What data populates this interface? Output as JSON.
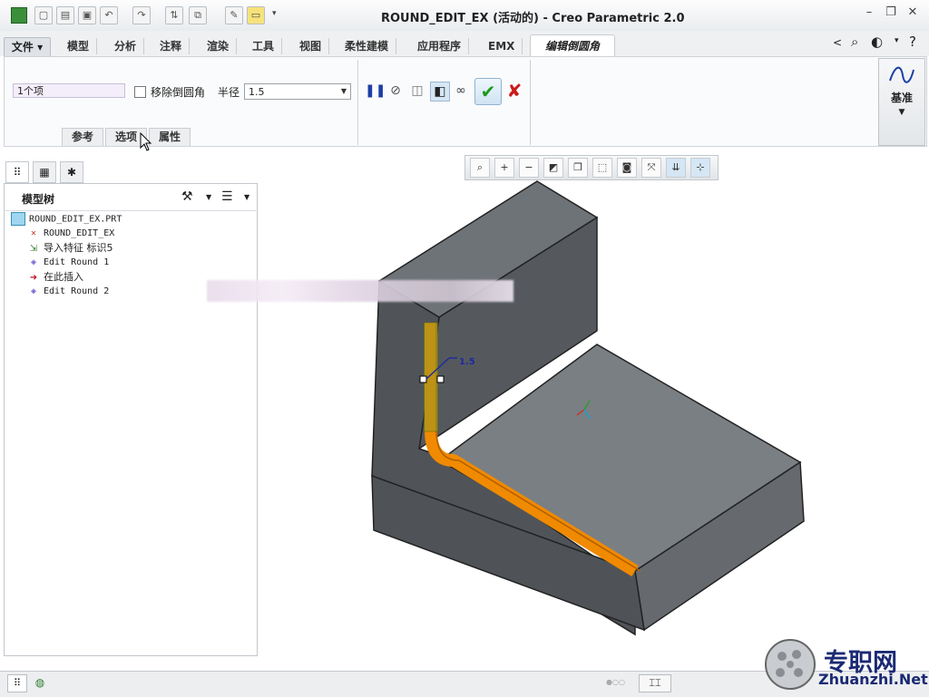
{
  "window": {
    "title": "ROUND_EDIT_EX (活动的) - Creo Parametric 2.0"
  },
  "ribbon": {
    "file_menu": "文件",
    "tabs": [
      "模型",
      "分析",
      "注释",
      "渲染",
      "工具",
      "视图",
      "柔性建模",
      "应用程序",
      "EMX"
    ],
    "active_tab": "编辑倒圆角",
    "selection_field": "1个项",
    "remove_round_label": "移除倒圆角",
    "radius_label": "半径",
    "radius_value": "1.5",
    "subtabs": [
      "参考",
      "选项",
      "属性"
    ],
    "datum_label": "基准"
  },
  "model_tree": {
    "title": "模型树",
    "items": [
      {
        "label": "ROUND_EDIT_EX.PRT",
        "icon": "part-icon"
      },
      {
        "label": "ROUND_EDIT_EX",
        "icon": "datum-csys-icon"
      },
      {
        "label": "导入特征 标识5",
        "icon": "import-feature-icon"
      },
      {
        "label": "Edit Round 1",
        "icon": "edit-round-icon"
      },
      {
        "label": "在此插入",
        "icon": "insert-here-arrow-icon"
      },
      {
        "label": "Edit Round 2",
        "icon": "edit-round-new-icon"
      }
    ]
  },
  "graphics": {
    "dimension_label": "1.5",
    "highlight_color": "#f08a00",
    "body_color": "#6f7479"
  },
  "watermark": {
    "text": "专职网",
    "url": "Zhuanzhi.Net"
  }
}
